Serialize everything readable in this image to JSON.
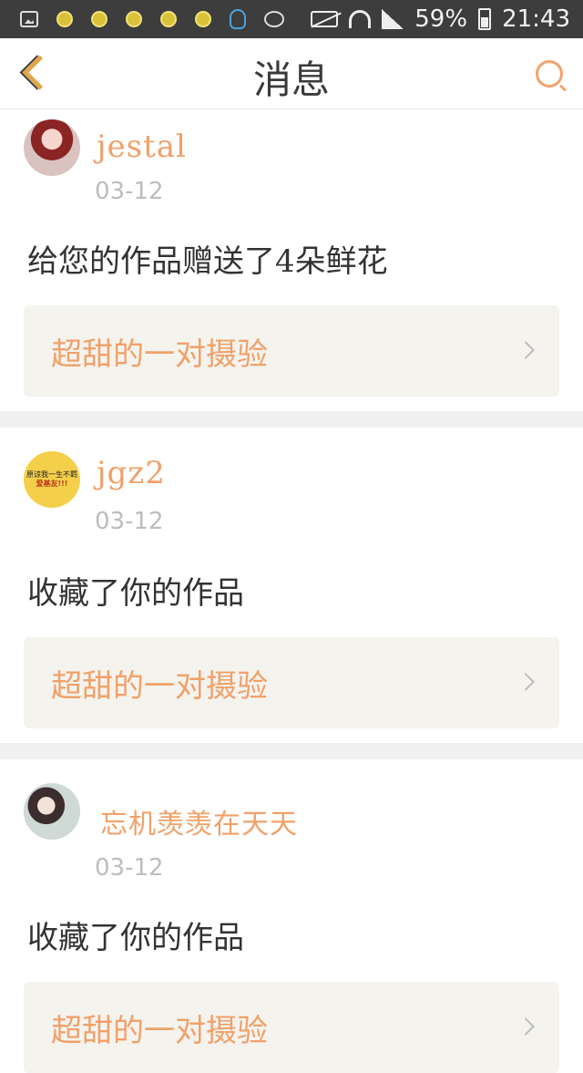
{
  "status_bar": {
    "battery": "59%",
    "time": "21:43"
  },
  "header": {
    "title": "消息"
  },
  "messages": [
    {
      "username": "jestal",
      "date": "03-12",
      "text": "给您的作品赠送了4朵鲜花",
      "work_title": "超甜的一对摄验"
    },
    {
      "username": "jgz2",
      "avatar_text": [
        "原谅我一生不羁",
        "爱基友!!!"
      ],
      "date": "03-12",
      "text": "收藏了你的作品",
      "work_title": "超甜的一对摄验"
    },
    {
      "username": "忘机羡羡在天天",
      "date": "03-12",
      "text": "收藏了你的作品",
      "work_title": "超甜的一对摄验"
    }
  ],
  "colors": {
    "accent": "#f0a16a",
    "statusbar": "#3d3d3d",
    "card_bg": "#f4f3ee"
  },
  "icons": [
    "gallery-icon",
    "lightbulb-icon",
    "qq-icon",
    "camera-icon",
    "mute-icon",
    "wifi-icon",
    "signal-icon",
    "battery-icon",
    "back-chevron-icon",
    "search-icon",
    "chevron-right-icon"
  ]
}
